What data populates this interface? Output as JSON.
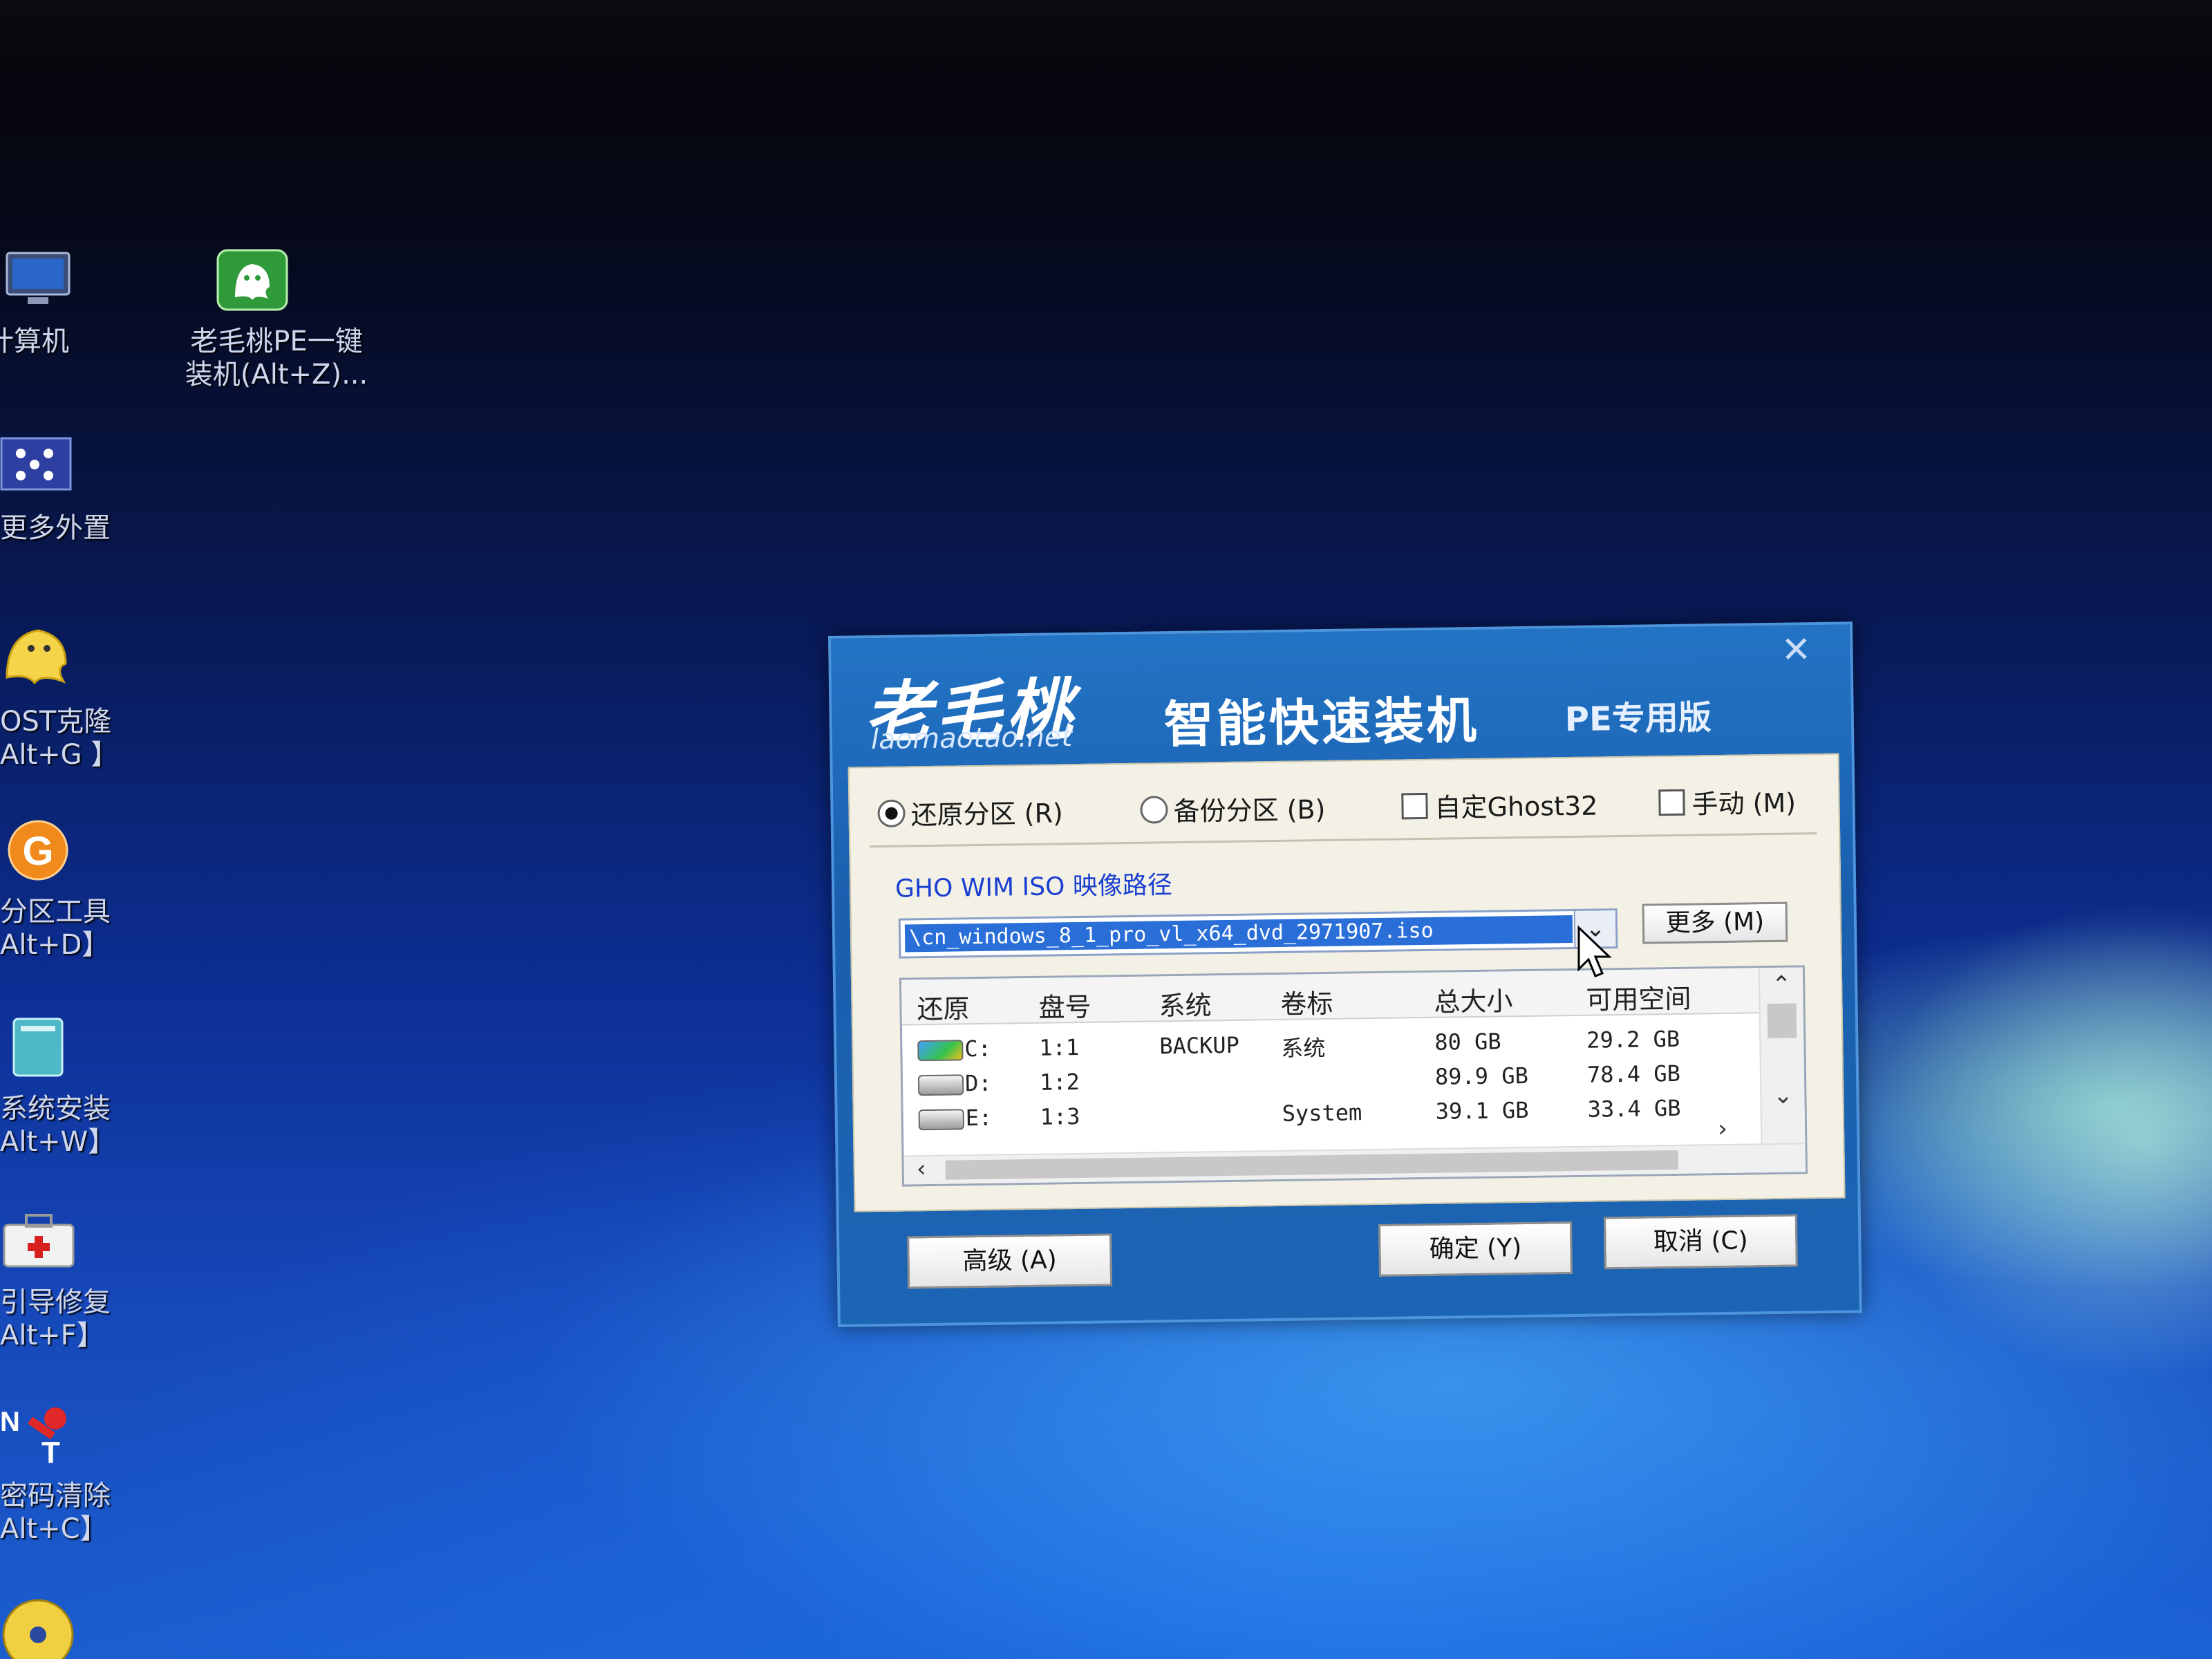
{
  "desktop": {
    "icons": [
      {
        "id": "computer",
        "label": "计算机"
      },
      {
        "id": "onekey",
        "label": "老毛桃PE一键\n装机(Alt+Z)..."
      },
      {
        "id": "peripherals",
        "label": "更多外置"
      },
      {
        "id": "ghost",
        "label": "OST克隆\nAlt+G 】"
      },
      {
        "id": "partition",
        "label": "分区工具\nAlt+D】"
      },
      {
        "id": "sysinstall",
        "label": "系统安装\nAlt+W】"
      },
      {
        "id": "bootrepair",
        "label": "引导修复\nAlt+F】"
      },
      {
        "id": "pwclear",
        "label": "密码清除\nAlt+C】"
      }
    ]
  },
  "dialog": {
    "close": "✕",
    "brand_cn": "老毛桃",
    "brand_url": "laomaotao.net",
    "title": "智能快速装机",
    "edition": "PE专用版",
    "options": {
      "restore": "还原分区 (R)",
      "backup": "备份分区 (B)",
      "ghost32": "自定Ghost32",
      "manual": "手动 (M)"
    },
    "path_label": "GHO WIM ISO 映像路径",
    "path_value": "\\cn_windows_8_1_pro_vl_x64_dvd_2971907.iso",
    "more_button": "更多 (M)",
    "table": {
      "headers": [
        "还原",
        "盘号",
        "系统",
        "卷标",
        "总大小",
        "可用空间"
      ],
      "rows": [
        {
          "drive": "C:",
          "num": "1:1",
          "system": "BACKUP",
          "label": "系统",
          "total": "80  GB",
          "free": "29.2  GB",
          "icon": "windows-drive-icon"
        },
        {
          "drive": "D:",
          "num": "1:2",
          "system": "",
          "label": "",
          "total": "89.9  GB",
          "free": "78.4  GB",
          "icon": "drive-icon"
        },
        {
          "drive": "E:",
          "num": "1:3",
          "system": "",
          "label": "System",
          "total": "39.1  GB",
          "free": "33.4  GB",
          "icon": "drive-icon"
        }
      ]
    },
    "advanced_button": "高级 (A)",
    "ok_button": "确定 (Y)",
    "cancel_button": "取消 (C)"
  }
}
